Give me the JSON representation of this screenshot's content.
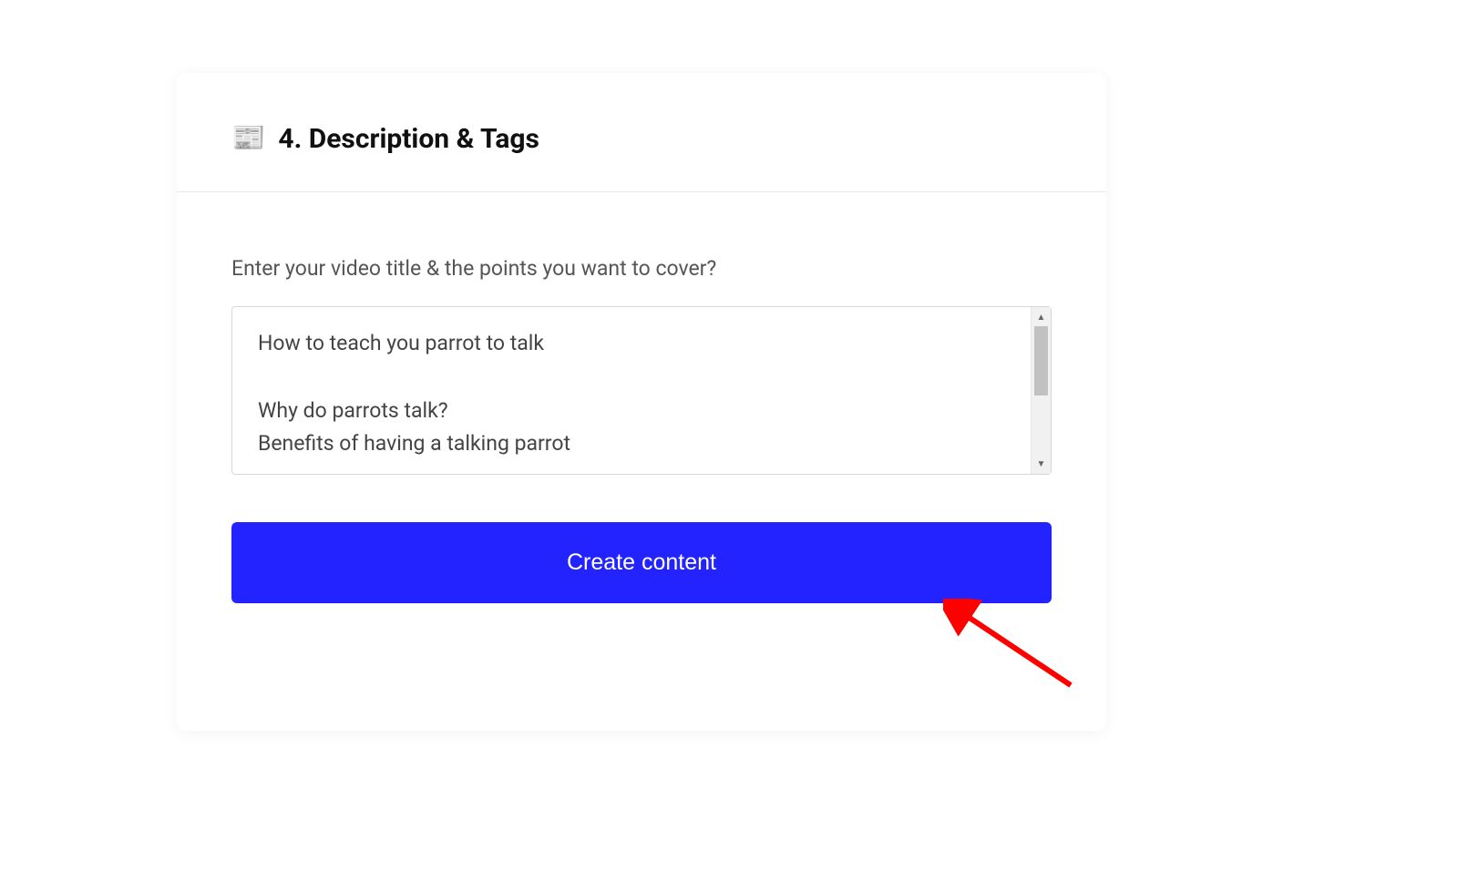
{
  "section": {
    "icon": "📰",
    "title": "4. Description & Tags"
  },
  "form": {
    "prompt_label": "Enter your video title & the points you want to cover?",
    "textarea_value": "How to teach you parrot to talk\n\nWhy do parrots talk?\nBenefits of having a talking parrot",
    "submit_label": "Create content"
  },
  "colors": {
    "primary_button": "#2323ff",
    "annotation_arrow": "#ff0000"
  }
}
